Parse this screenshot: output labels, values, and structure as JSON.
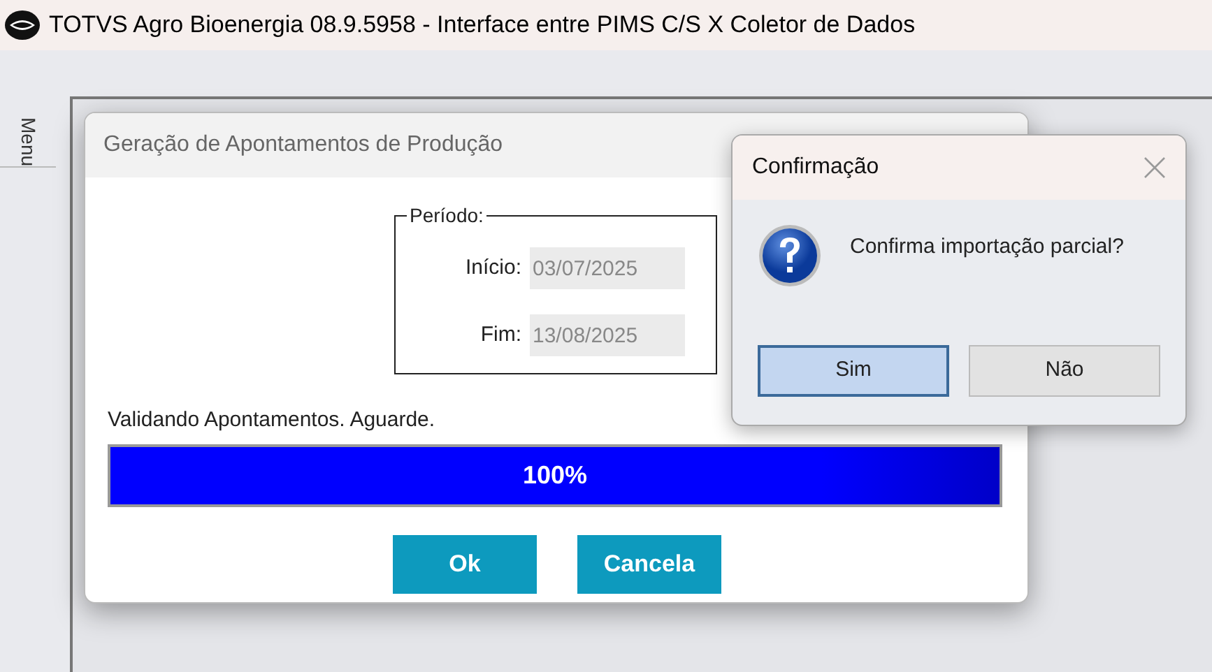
{
  "window": {
    "title": "TOTVS Agro Bioenergia 08.9.5958 - Interface entre PIMS C/S X Coletor de Dados"
  },
  "side_tab": {
    "label": "Menu"
  },
  "production_dialog": {
    "title": "Geração de Apontamentos de Produção",
    "period": {
      "legend": "Período:",
      "start_label": "Início:",
      "start_value": "03/07/2025",
      "end_label": "Fim:",
      "end_value": "13/08/2025"
    },
    "status": "Validando Apontamentos. Aguarde.",
    "progress": {
      "level": 1,
      "reading": "100%"
    },
    "buttons": [
      "Ok",
      "Cancela"
    ]
  },
  "confirm_dialog": {
    "title": "Confirmação",
    "message": "Confirma importação parcial?",
    "buttons": [
      {
        "label": "Sim",
        "selected": true
      },
      {
        "label": "Não",
        "selected": false
      }
    ]
  }
}
